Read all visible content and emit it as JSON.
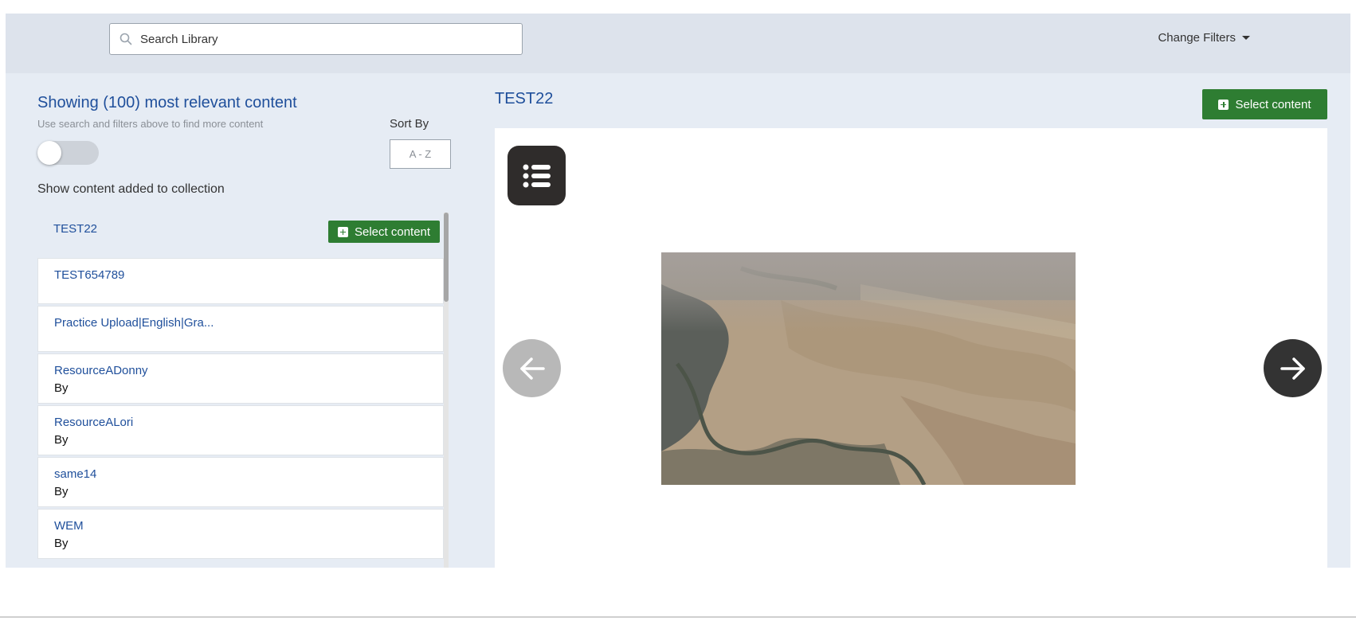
{
  "search": {
    "placeholder": "Search Library"
  },
  "filters": {
    "label": "Change Filters"
  },
  "left": {
    "title": "Showing (100) most relevant content",
    "subtitle": "Use search and filters above to find more content",
    "sort_label": "Sort By",
    "sort_value": "A - Z",
    "toggle_label": "Show content added to collection",
    "toggle_on": false
  },
  "selected": {
    "title": "TEST22",
    "button_label": "Select content"
  },
  "items": [
    {
      "title": "TEST654789",
      "by": ""
    },
    {
      "title": "Practice Upload|English|Gra...",
      "by": ""
    },
    {
      "title": "ResourceADonny",
      "by": "By"
    },
    {
      "title": "ResourceALori",
      "by": "By"
    },
    {
      "title": "same14",
      "by": "By"
    },
    {
      "title": "WEM",
      "by": "By"
    }
  ],
  "preview": {
    "title": "TEST22",
    "button_label": "Select content"
  },
  "icons": {
    "search": "search-icon",
    "caret": "chevron-down-icon",
    "plus": "plus-square-icon",
    "list": "list-icon",
    "prev": "arrow-left-icon",
    "next": "arrow-right-icon"
  },
  "colors": {
    "accent_blue": "#1f4f9b",
    "button_green": "#2e7d32"
  }
}
